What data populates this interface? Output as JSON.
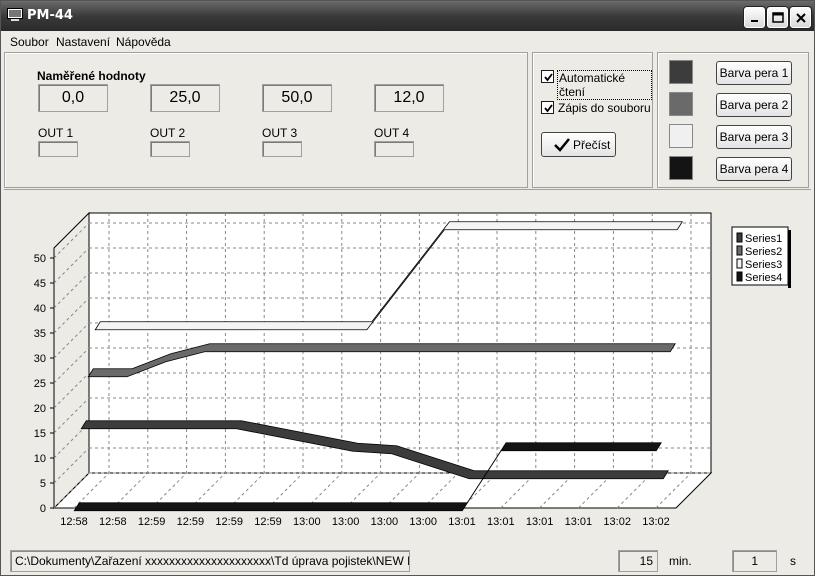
{
  "window": {
    "title": "PM-44"
  },
  "menu": [
    "Soubor",
    "Nastavení",
    "Nápověda"
  ],
  "measured": {
    "heading": "Naměřené hodnoty",
    "values": [
      "0,0",
      "25,0",
      "50,0",
      "12,0"
    ],
    "outputs": [
      "OUT 1",
      "OUT 2",
      "OUT 3",
      "OUT 4"
    ]
  },
  "options": {
    "auto_read_label": "Automatické čtení",
    "auto_read_checked": true,
    "log_to_file_label": "Zápis do souboru",
    "log_to_file_checked": true,
    "read_button": "Přečíst"
  },
  "pens": {
    "buttons": [
      "Barva pera 1",
      "Barva pera 2",
      "Barva pera 3",
      "Barva pera 4"
    ],
    "colors": [
      "#3c3c3c",
      "#6a6a6a",
      "#f0f0f0",
      "#141414"
    ]
  },
  "chart_data": {
    "type": "line",
    "categories": [
      "12:58",
      "12:58",
      "12:59",
      "12:59",
      "12:59",
      "12:59",
      "13:00",
      "13:00",
      "13:00",
      "13:00",
      "13:01",
      "13:01",
      "13:01",
      "13:01",
      "13:02",
      "13:02"
    ],
    "ylim": [
      0,
      50
    ],
    "yticks": [
      "0",
      "5",
      "10",
      "15",
      "20",
      "25",
      "30",
      "35",
      "40",
      "45",
      "50"
    ],
    "grid": true,
    "legend_position": "right",
    "series": [
      {
        "name": "Series1",
        "color": "#3c3c3c",
        "values": [
          15,
          15,
          15,
          15,
          15,
          13.5,
          12,
          10.5,
          10,
          7.5,
          5,
          5,
          5,
          5,
          5,
          5
        ]
      },
      {
        "name": "Series2",
        "color": "#6a6a6a",
        "values": [
          24,
          24,
          27,
          29,
          29,
          29,
          29,
          29,
          29,
          29,
          29,
          29,
          29,
          29,
          29,
          29
        ]
      },
      {
        "name": "Series3",
        "color": "#f4f4f4",
        "values": [
          32,
          32,
          32,
          32,
          32,
          32,
          32,
          32,
          42,
          52,
          52,
          52,
          52,
          52,
          52,
          52
        ]
      },
      {
        "name": "Series4",
        "color": "#141414",
        "values": [
          0,
          0,
          0,
          0,
          0,
          0,
          0,
          0,
          0,
          0,
          0,
          12,
          12,
          12,
          12,
          12
        ]
      }
    ]
  },
  "status": {
    "path": "C:\\Dokumenty\\Zařazení xxxxxxxxxxxxxxxxxxxxx\\Td úprava pojistek\\NEW Regulá",
    "interval_value": "15",
    "interval_unit": "min.",
    "step_value": "1",
    "step_unit": "s"
  }
}
